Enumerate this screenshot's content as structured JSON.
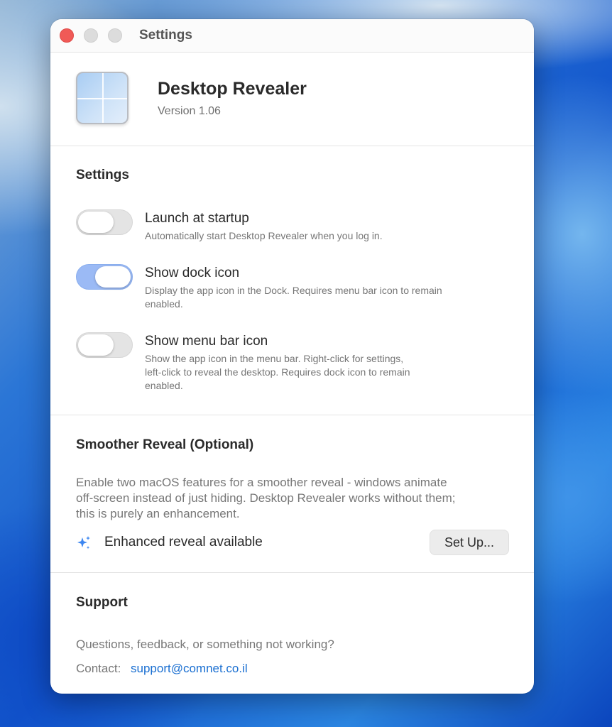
{
  "window": {
    "title": "Settings"
  },
  "app": {
    "name": "Desktop Revealer",
    "version": "Version 1.06",
    "icon": "app-window-grid-icon"
  },
  "settings": {
    "title": "Settings",
    "options": [
      {
        "label": "Launch at startup",
        "description": "Automatically start Desktop Revealer when you log in.",
        "enabled": false
      },
      {
        "label": "Show dock icon",
        "description_lines": [
          "Display the app icon in the Dock. Requires menu bar icon to remain",
          "enabled."
        ],
        "enabled": true
      },
      {
        "label": "Show menu bar icon",
        "description_lines": [
          "Show the app icon in the menu bar. Right-click for settings,",
          "left-click to reveal the desktop. Requires dock icon to remain",
          "enabled."
        ],
        "enabled": false
      }
    ]
  },
  "smoother": {
    "title": "Smoother Reveal (Optional)",
    "body_lines": [
      "Enable two macOS features for a smoother reveal - windows animate",
      "off-screen instead of just hiding. Desktop Revealer works without them;",
      "this is purely an enhancement."
    ],
    "status_icon": "sparkle-icon",
    "status_label": "Enhanced reveal available",
    "setup_button": "Set Up..."
  },
  "support": {
    "title": "Support",
    "question": "Questions, feedback, or something not working?",
    "contact_label": "Contact:",
    "contact_email": "support@comnet.co.il"
  },
  "colors": {
    "toggle_on": "#9bbaf5",
    "link": "#1a6fd1",
    "close_button": "#f05a57"
  }
}
